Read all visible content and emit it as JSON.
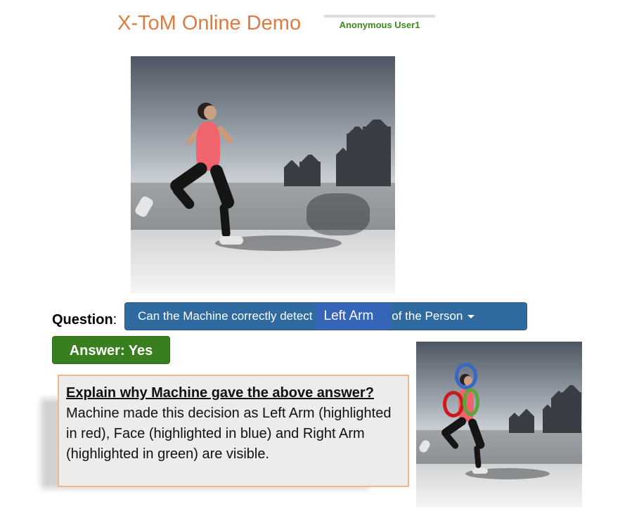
{
  "header": {
    "title": "X-ToM Online Demo",
    "user": "Anonymous User1"
  },
  "question": {
    "label": "Question",
    "label_suffix": ":",
    "prefix": "Can the Machine correctly detect",
    "selected_part": "Left Arm",
    "suffix": "of the Person"
  },
  "answer": {
    "label": "Answer: Yes"
  },
  "explanation": {
    "heading": "Explain why Machine gave the above answer?",
    "body": "Machine made this decision as Left Arm (highlighted in red), Face (highlighted in blue) and Right Arm (highlighted in green) are visible."
  },
  "highlight_colors": {
    "left_arm": "#cc1a1a",
    "face": "#3a66c4",
    "right_arm": "#5aa63a"
  },
  "colors": {
    "title": "#e07a3f",
    "user": "#3d8b1e",
    "question_bar": "#2f6aa0",
    "answer": "#3a7f1f"
  }
}
